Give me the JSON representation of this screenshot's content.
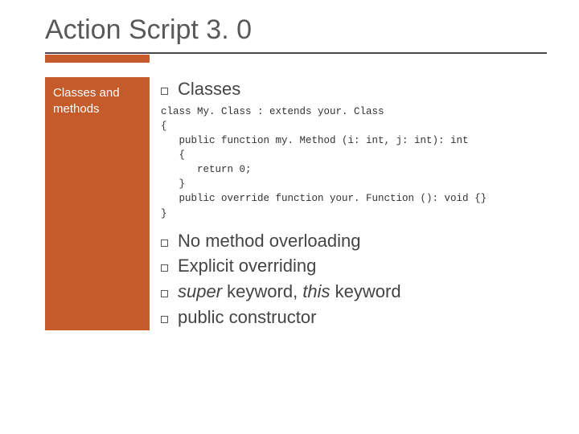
{
  "title": "Action Script 3. 0",
  "sidebar": {
    "label": "Classes and methods"
  },
  "main": {
    "heading": "Classes",
    "code": "class My. Class : extends your. Class\n{\n   public function my. Method (i: int, j: int): int\n   {\n      return 0;\n   }\n   public override function your. Function (): void {}\n}",
    "bullets": [
      {
        "text": "No method overloading"
      },
      {
        "text": "Explicit overriding"
      },
      {
        "prefix_italic": "super",
        "mid": " keyword, ",
        "italic2": "this",
        "suffix": " keyword"
      },
      {
        "text": "public constructor"
      }
    ]
  }
}
